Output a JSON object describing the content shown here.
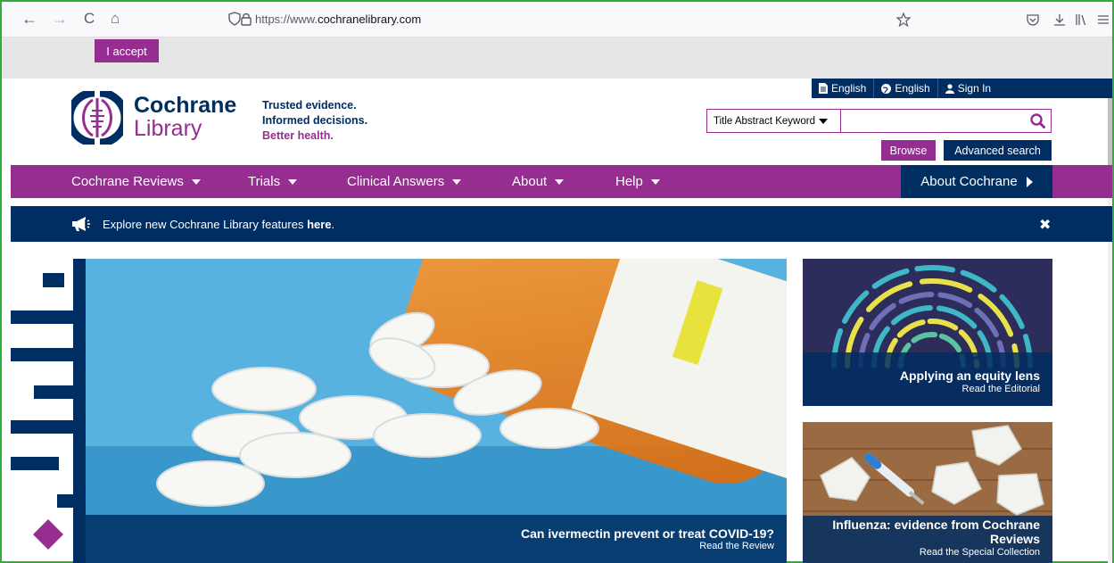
{
  "browser": {
    "url_prefix": "https://www.",
    "url_domain": "cochranelibrary.com",
    "back": "←",
    "forward": "→",
    "reload": "C",
    "home": "⌂"
  },
  "cookie": {
    "accept_label": "I accept"
  },
  "topbar": {
    "lang1": "English",
    "lang2": "English",
    "sign_in": "Sign In"
  },
  "logo": {
    "line1": "Cochrane",
    "line2": "Library"
  },
  "tagline": {
    "l1": "Trusted evidence.",
    "l2": "Informed decisions.",
    "l3": "Better health."
  },
  "search": {
    "scope": "Title Abstract Keyword",
    "value": ""
  },
  "buttons": {
    "browse": "Browse",
    "advanced": "Advanced search"
  },
  "nav": {
    "items": [
      {
        "label": "Cochrane Reviews"
      },
      {
        "label": "Trials"
      },
      {
        "label": "Clinical Answers"
      },
      {
        "label": "About"
      },
      {
        "label": "Help"
      }
    ],
    "about_cochrane": "About Cochrane"
  },
  "banner": {
    "text": "Explore new Cochrane Library features ",
    "link": "here",
    "end": "."
  },
  "hero": {
    "title": "Can ivermectin prevent or treat COVID-19?",
    "subtitle": "Read the Review"
  },
  "cards": [
    {
      "title": "Applying an equity lens",
      "subtitle": "Read the Editorial"
    },
    {
      "title": "Influenza: evidence from Cochrane Reviews",
      "subtitle": "Read the Special Collection"
    }
  ],
  "colors": {
    "purple": "#962d91",
    "navy": "#002d62"
  }
}
